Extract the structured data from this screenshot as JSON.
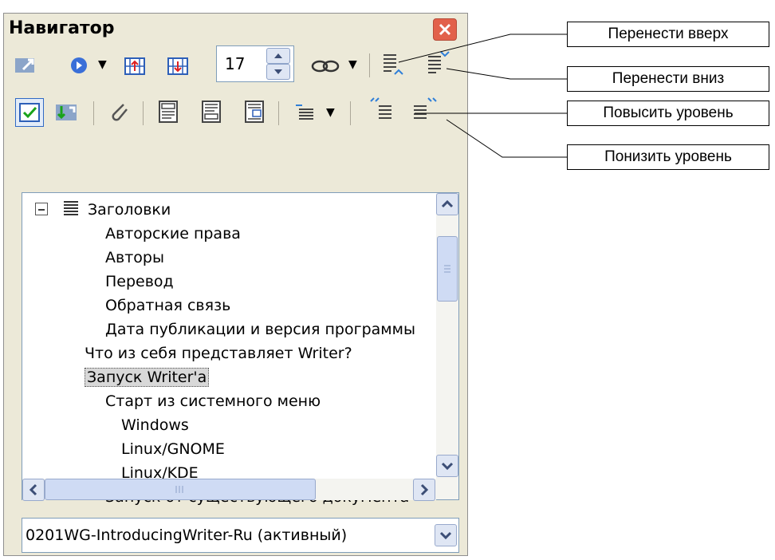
{
  "window": {
    "title": "Навигатор"
  },
  "toolbar": {
    "spin_value": "17"
  },
  "tree": {
    "items": [
      {
        "label": "Заголовки",
        "level": 0
      },
      {
        "label": "Авторские права",
        "level": 2
      },
      {
        "label": "Авторы",
        "level": 2
      },
      {
        "label": "Перевод",
        "level": 2
      },
      {
        "label": "Обратная связь",
        "level": 2
      },
      {
        "label": "Дата публикации и версия программы",
        "level": 2
      },
      {
        "label": "Что из себя представляет Writer?",
        "level": 1
      },
      {
        "label": "Запуск Writer'a",
        "level": 1,
        "selected": true
      },
      {
        "label": "Старт из системного меню",
        "level": 2
      },
      {
        "label": "Windows",
        "level": 3
      },
      {
        "label": "Linux/GNOME",
        "level": 3
      },
      {
        "label": "Linux/KDE",
        "level": 3
      },
      {
        "label": "Запуск от существующего документа",
        "level": 2
      }
    ]
  },
  "document": {
    "selected": "0201WG-IntroducingWriter-Ru (активный)"
  },
  "callouts": {
    "move_up": "Перенести вверх",
    "move_down": "Перенести вниз",
    "promote": "Повысить уровень",
    "demote": "Понизить уровень"
  },
  "colors": {
    "window_bg": "#ece9d8",
    "close_button": "#e2614b",
    "selection": "#d8d8d8"
  }
}
